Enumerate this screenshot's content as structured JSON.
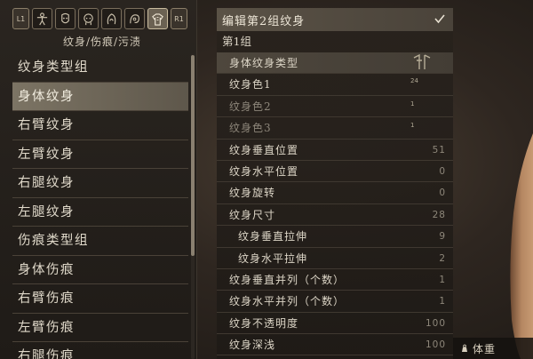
{
  "tabs": {
    "left_hint": "L1",
    "right_hint": "R1",
    "icons": [
      "figure-icon",
      "face-icon",
      "head-icon",
      "hair-icon",
      "eye-icon",
      "body-tattoo-icon"
    ]
  },
  "category_title": "纹身/伤痕/污渍",
  "categories": [
    "纹身类型组",
    "身体纹身",
    "右臂纹身",
    "左臂纹身",
    "右腿纹身",
    "左腿纹身",
    "伤痕类型组",
    "身体伤痕",
    "右臂伤痕",
    "左臂伤痕",
    "右腿伤痕"
  ],
  "selected_category_index": 1,
  "settings": {
    "header": "编辑第2组纹身",
    "group_title": "第1组",
    "rows": [
      {
        "label": "身体纹身类型",
        "value": ""
      },
      {
        "label": "纹身色1",
        "value": ""
      },
      {
        "label": "纹身色2",
        "value": ""
      },
      {
        "label": "纹身色3",
        "value": ""
      },
      {
        "label": "纹身垂直位置",
        "value": "51"
      },
      {
        "label": "纹身水平位置",
        "value": "0"
      },
      {
        "label": "纹身旋转",
        "value": "0"
      },
      {
        "label": "纹身尺寸",
        "value": "28"
      },
      {
        "label": "纹身垂直拉伸",
        "value": "9"
      },
      {
        "label": "纹身水平拉伸",
        "value": "2"
      },
      {
        "label": "纹身垂直并列（个数）",
        "value": "1"
      },
      {
        "label": "纹身水平并列（个数）",
        "value": "1"
      },
      {
        "label": "纹身不透明度",
        "value": "100"
      },
      {
        "label": "纹身深浅",
        "value": "100"
      }
    ],
    "palette_numbers": [
      "24",
      "1",
      "1"
    ]
  },
  "weight_label": "体重",
  "colors": {
    "selected_bg": "#6b6253",
    "accent_text": "#e0d9ca"
  }
}
